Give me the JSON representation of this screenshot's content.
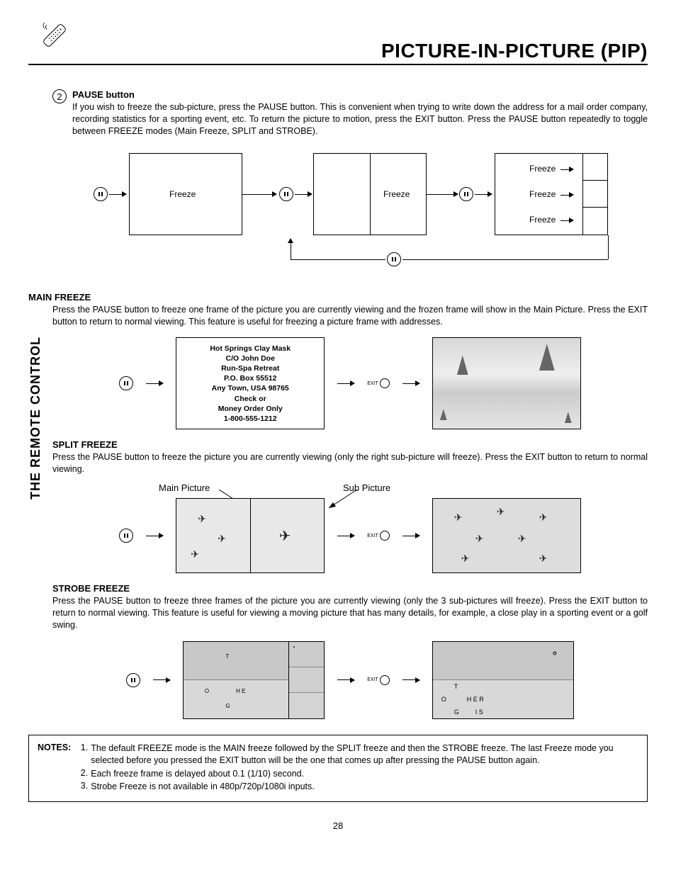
{
  "header": {
    "title": "PICTURE-IN-PICTURE (PIP)",
    "side_tab": "THE REMOTE CONTROL"
  },
  "step": {
    "number": "2",
    "title": "PAUSE button",
    "text": "If you wish to freeze the sub-picture, press the PAUSE button. This is convenient when trying to write down the address for a mail order company, recording statistics for a sporting event, etc.  To return the picture to motion, press the EXIT button.  Press the PAUSE button repeatedly to toggle between FREEZE modes (Main Freeze, SPLIT and STROBE)."
  },
  "diag1": {
    "freeze": "Freeze"
  },
  "main_freeze": {
    "title": "MAIN FREEZE",
    "text": "Press the PAUSE button to freeze one frame of the picture you are currently viewing and the frozen frame will show in the Main Picture.  Press the EXIT button to return to normal viewing.  This feature is useful for freezing a picture frame with addresses.",
    "addr": {
      "l1": "Hot Springs Clay Mask",
      "l2": "C/O John Doe",
      "l3": "Run-Spa Retreat",
      "l4": "P.O. Box 55512",
      "l5": "Any Town, USA 98765",
      "l6": "Check or",
      "l7": "Money Order Only",
      "l8": "1-800-555-1212"
    }
  },
  "split_freeze": {
    "title": "SPLIT FREEZE",
    "text": "Press the PAUSE button to freeze the picture you are currently viewing (only the right sub-picture will freeze).  Press the EXIT button to return to normal viewing.",
    "main_label": "Main Picture",
    "sub_label": "Sub Picture"
  },
  "strobe_freeze": {
    "title": "STROBE FREEZE",
    "text": "Press the PAUSE button to freeze three frames of the picture you are currently viewing (only the 3 sub-pictures will freeze). Press the EXIT button to return to normal viewing. This feature is useful for viewing a moving picture that has many details, for example, a close play in a sporting event or a golf swing."
  },
  "notes": {
    "label": "NOTES:",
    "items": [
      "The default FREEZE mode is the MAIN freeze followed by the SPLIT freeze and then the STROBE freeze.  The last Freeze mode you selected before you pressed the EXIT button will be the one that comes up after pressing the PAUSE button again.",
      "Each freeze frame is delayed about 0.1 (1/10) second.",
      "Strobe Freeze is not available in 480p/720p/1080i inputs."
    ]
  },
  "exit_label": "EXIT",
  "page_number": "28"
}
